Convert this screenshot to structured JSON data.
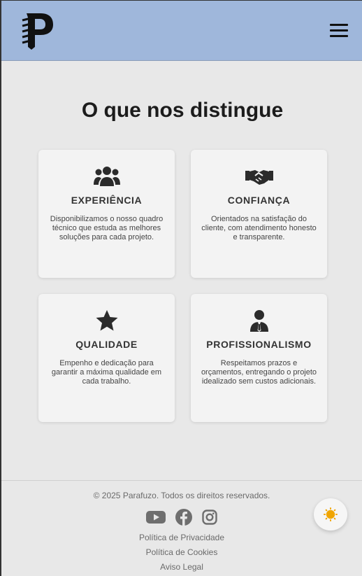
{
  "header": {
    "logo_letter": "P",
    "menu_icon": "hamburger-menu-icon"
  },
  "main": {
    "title": "O que nos distingue",
    "cards": [
      {
        "icon": "users-group-icon",
        "title": "EXPERIÊNCIA",
        "description": "Disponibilizamos o nosso quadro técnico que estuda as melhores soluções para cada projeto."
      },
      {
        "icon": "handshake-icon",
        "title": "CONFIANÇA",
        "description": "Orientados na satisfação do cliente, com atendimento honesto e transparente."
      },
      {
        "icon": "star-icon",
        "title": "QUALIDADE",
        "description": "Empenho e dedicação para garantir a máxima qualidade em cada trabalho."
      },
      {
        "icon": "businessman-icon",
        "title": "PROFISSIONALISMO",
        "description": "Respeitamos prazos e orçamentos, entregando o projeto idealizado sem custos adicionais."
      }
    ]
  },
  "footer": {
    "copyright": "© 2025 Parafuzo. Todos os direitos reservados.",
    "social": [
      "youtube-icon",
      "facebook-icon",
      "instagram-icon"
    ],
    "links": {
      "privacy": "Política de Privacidade",
      "cookies": "Política de Cookies",
      "legal": "Aviso Legal"
    }
  },
  "theme_toggle": {
    "icon": "sun-icon",
    "color": "#f0a500"
  },
  "colors": {
    "header_bg": "#9fb7db",
    "page_bg": "#e8e8e8",
    "card_bg": "#f3f3f3",
    "text_dark": "#1c1c1c"
  }
}
